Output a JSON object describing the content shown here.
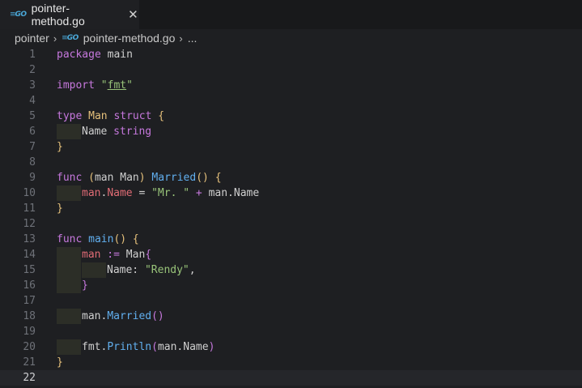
{
  "tab": {
    "title": "pointer-method.go",
    "close": "✕"
  },
  "breadcrumb": {
    "folder": "pointer",
    "file": "pointer-method.go",
    "more": "..."
  },
  "lines": [
    {
      "n": "1"
    },
    {
      "n": "2"
    },
    {
      "n": "3"
    },
    {
      "n": "4"
    },
    {
      "n": "5"
    },
    {
      "n": "6"
    },
    {
      "n": "7"
    },
    {
      "n": "8"
    },
    {
      "n": "9"
    },
    {
      "n": "10"
    },
    {
      "n": "11"
    },
    {
      "n": "12"
    },
    {
      "n": "13"
    },
    {
      "n": "14"
    },
    {
      "n": "15"
    },
    {
      "n": "16"
    },
    {
      "n": "17"
    },
    {
      "n": "18"
    },
    {
      "n": "19"
    },
    {
      "n": "20"
    },
    {
      "n": "21"
    },
    {
      "n": "22"
    }
  ],
  "code": {
    "l1_kw": "package",
    "l1_name": " main",
    "l3_kw": "import",
    "l3_q1": " \"",
    "l3_pkg": "fmt",
    "l3_q2": "\"",
    "l5_kw": "type",
    "l5_type": " Man",
    "l5_kw2": " struct",
    "l5_brace": " {",
    "l6_field": "Name",
    "l6_type": " string",
    "l7_brace": "}",
    "l9_kw": "func",
    "l9_open": " (",
    "l9_recv": "man",
    "l9_rtype": " Man",
    "l9_close": ")",
    "l9_fn": " Married",
    "l9_parens": "()",
    "l9_brace": " {",
    "l10_var": "man",
    "l10_dot": ".",
    "l10_field": "Name",
    "l10_eq": " = ",
    "l10_str": "\"Mr. \"",
    "l10_plus": " + ",
    "l10_rest": "man.Name",
    "l11_brace": "}",
    "l13_kw": "func",
    "l13_fn": " main",
    "l13_parens": "()",
    "l13_brace": " {",
    "l14_var": "man",
    "l14_op": " :=",
    "l14_type": " Man",
    "l14_brace": "{",
    "l15_field": "Name: ",
    "l15_str": "\"Rendy\"",
    "l15_comma": ",",
    "l16_brace": "}",
    "l18_obj": "man.",
    "l18_fn": "Married",
    "l18_parens": "()",
    "l20_obj": "fmt.",
    "l20_fn": "Println",
    "l20_open": "(",
    "l20_arg": "man.Name",
    "l20_close": ")",
    "l21_brace": "}"
  },
  "colors": {
    "keyword": "#c678dd",
    "type": "#e5c07b",
    "function": "#61afef",
    "string": "#98c379",
    "variable": "#e06c75",
    "go_logo": "#4aa8d8"
  },
  "icons": {
    "tab_file_icon": "go-file-icon",
    "close_icon": "close-icon",
    "crumb_file_icon": "go-file-icon"
  }
}
